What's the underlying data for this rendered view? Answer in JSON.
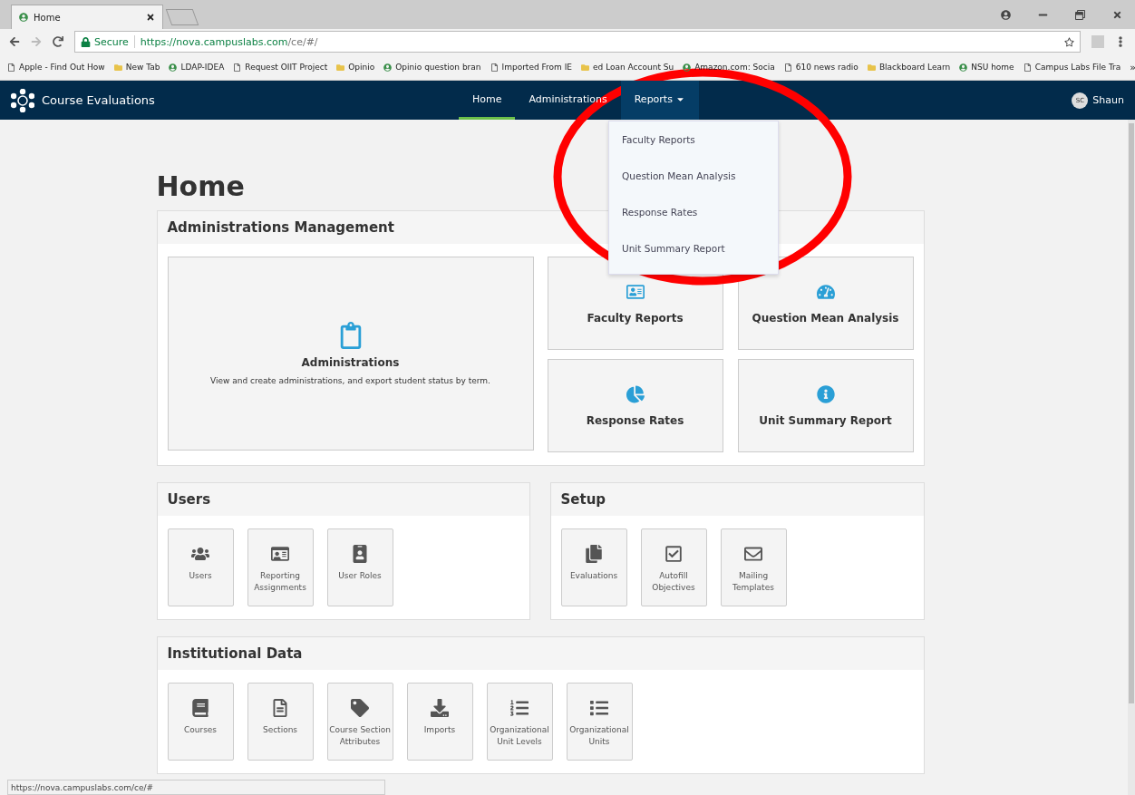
{
  "browser": {
    "tab_title": "Home",
    "address": {
      "secure_label": "Secure",
      "host": "https://nova.campuslabs.com",
      "path": "/ce/#/"
    },
    "bookmarks": [
      "Apple - Find Out How",
      "New Tab",
      "LDAP-IDEA",
      "Request OIIT Project",
      "Opinio",
      "Opinio question bran",
      "Imported From IE",
      "ed Loan Account Su",
      "Amazon.com: Socia",
      "610 news radio",
      "Blackboard Learn",
      "NSU home",
      "Campus Labs File Tra"
    ],
    "bookmarks_overflow": "»"
  },
  "app_bar": {
    "brand": "Course Evaluations",
    "nav": [
      {
        "label": "Home",
        "selected": true,
        "has_menu": false
      },
      {
        "label": "Administrations",
        "selected": false,
        "has_menu": false
      },
      {
        "label": "Reports",
        "selected": false,
        "has_menu": true,
        "expanded": true
      }
    ],
    "user": {
      "initials": "SC",
      "name": "Shaun"
    }
  },
  "reports_menu": [
    "Faculty Reports",
    "Question Mean Analysis",
    "Response Rates",
    "Unit Summary Report"
  ],
  "page_title": "Home",
  "administrations_management": {
    "title": "Administrations Management",
    "main_tile": {
      "title": "Administrations",
      "description": "View and create administrations, and export student status by term."
    },
    "tiles": [
      "Faculty Reports",
      "Question Mean Analysis",
      "Response Rates",
      "Unit Summary Report"
    ]
  },
  "users": {
    "title": "Users",
    "tiles": [
      "Users",
      "Reporting Assignments",
      "User Roles"
    ]
  },
  "setup": {
    "title": "Setup",
    "tiles": [
      "Evaluations",
      "Autofill Objectives",
      "Mailing Templates"
    ]
  },
  "institutional_data": {
    "title": "Institutional Data",
    "tiles": [
      "Courses",
      "Sections",
      "Course Section Attributes",
      "Imports",
      "Organizational Unit Levels",
      "Organizational Units"
    ]
  },
  "status_bar": "https://nova.campuslabs.com/ce/#"
}
